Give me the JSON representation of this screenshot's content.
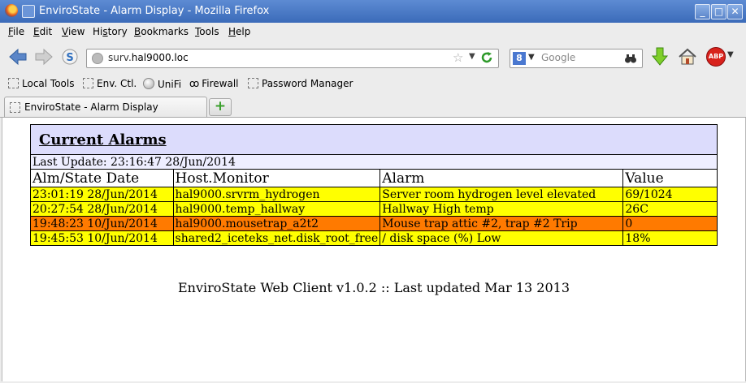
{
  "window": {
    "title": "EnviroState - Alarm Display - Mozilla Firefox",
    "min_label": "_",
    "max_label": "□",
    "close_label": "✕"
  },
  "menu": [
    {
      "label": "File"
    },
    {
      "label": "Edit"
    },
    {
      "label": "View"
    },
    {
      "label": "History"
    },
    {
      "label": "Bookmarks"
    },
    {
      "label": "Tools"
    },
    {
      "label": "Help"
    }
  ],
  "navbar": {
    "url_prefix": "surv.",
    "url_host": "hal9000.loc",
    "search_placeholder": "Google",
    "abp_label": "ABP"
  },
  "bookmarks": [
    {
      "label": "Local Tools",
      "icon": "folder-icon"
    },
    {
      "label": "Env. Ctl.",
      "icon": "folder-icon"
    },
    {
      "label": "UniFi",
      "icon": "globe-icon"
    },
    {
      "label": "Firewall",
      "icon": "firewall-icon"
    },
    {
      "label": "Password Manager",
      "icon": "folder-icon"
    }
  ],
  "tabs": [
    {
      "label": "EnviroState - Alarm Display"
    }
  ],
  "page": {
    "heading": "Current Alarms",
    "last_update_label": "Last Update: 23:16:47 28/Jun/2014",
    "columns": [
      "Alm/State Date",
      "Host.Monitor",
      "Alarm",
      "Value"
    ],
    "rows": [
      {
        "date": "23:01:19 28/Jun/2014",
        "monitor": "hal9000.srvrm_hydrogen",
        "alarm": "Server room hydrogen level elevated",
        "value": "69/1024",
        "severity": "warning"
      },
      {
        "date": "20:27:54 28/Jun/2014",
        "monitor": "hal9000.temp_hallway",
        "alarm": "Hallway High temp",
        "value": "26C",
        "severity": "warning"
      },
      {
        "date": "19:48:23 10/Jun/2014",
        "monitor": "hal9000.mousetrap_a2t2",
        "alarm": "Mouse trap attic #2, trap #2 Trip",
        "value": "0",
        "severity": "critical"
      },
      {
        "date": "19:45:53 10/Jun/2014",
        "monitor": "shared2_iceteks_net.disk_root_free",
        "alarm": "/ disk space (%) Low",
        "value": "18%",
        "severity": "warning"
      }
    ],
    "footer": "EnviroState Web Client v1.0.2 :: Last updated Mar 13 2013"
  },
  "colors": {
    "warning_row": "#ffff00",
    "critical_row": "#ff7a00",
    "header_bg": "#dcdcfc",
    "titlebar": "#4a7ac6"
  }
}
